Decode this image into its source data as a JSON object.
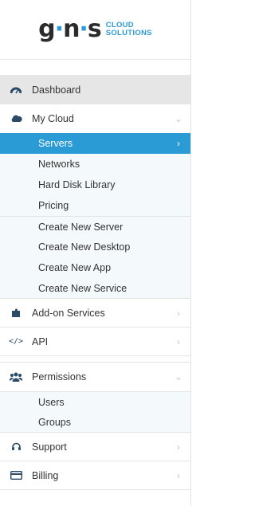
{
  "brand": {
    "mark_g": "g",
    "mark_n": "n",
    "mark_s": "s",
    "line1": "CLOUD",
    "line2": "SOLUTIONS"
  },
  "menu": {
    "dashboard": "Dashboard",
    "mycloud": "My Cloud",
    "servers": "Servers",
    "networks": "Networks",
    "hdl": "Hard Disk Library",
    "pricing": "Pricing",
    "create_server": "Create New Server",
    "create_desktop": "Create New Desktop",
    "create_app": "Create New App",
    "create_service": "Create New Service",
    "addons": "Add-on Services",
    "api": "API",
    "permissions": "Permissions",
    "users": "Users",
    "groups": "Groups",
    "support": "Support",
    "billing": "Billing"
  },
  "icons": {
    "dashboard": "speedometer-icon",
    "mycloud": "cloud-icon",
    "addons": "puzzle-icon",
    "api": "code-icon",
    "permissions": "users-group-icon",
    "support": "headset-icon",
    "billing": "credit-card-icon"
  },
  "colors": {
    "accent": "#2b9bd6",
    "icon": "#2a4a66",
    "submenu_bg": "#f4f9fc",
    "selected_bg": "#e6e6e6"
  }
}
